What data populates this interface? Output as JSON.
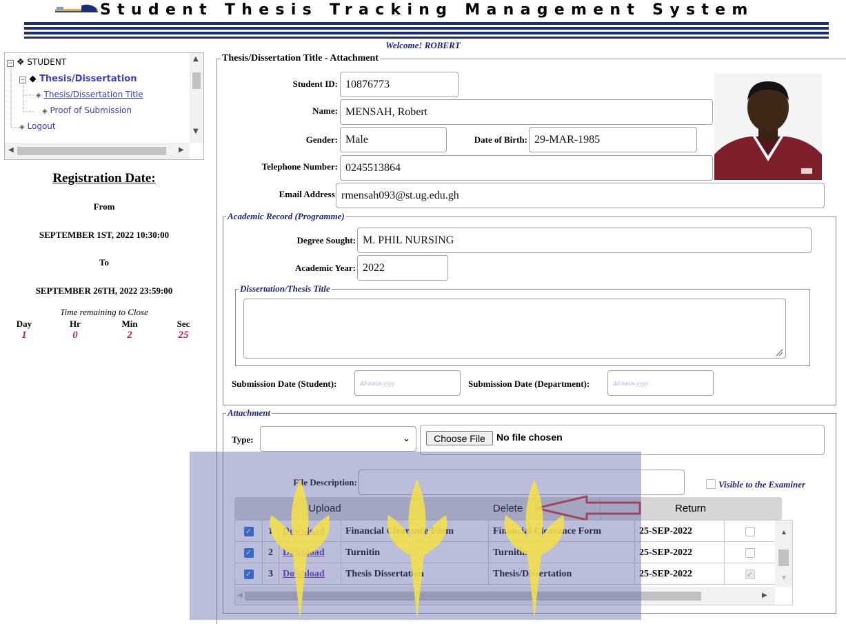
{
  "header": {
    "title": "Student Thesis Tracking Management System",
    "welcome": "Welcome! ROBERT"
  },
  "tree": {
    "root": "STUDENT",
    "section": "Thesis/Dissertation",
    "items": [
      "Thesis/Dissertation Title",
      "Proof of Submission"
    ],
    "logout": "Logout"
  },
  "registration": {
    "heading": "Registration Date:",
    "from_label": "From",
    "from_value": "SEPTEMBER 1ST, 2022 10:30:00",
    "to_label": "To",
    "to_value": "SEPTEMBER 26TH, 2022 23:59:00",
    "timer_label": "Time remaining to Close",
    "timer": [
      {
        "unit": "Day",
        "value": "1"
      },
      {
        "unit": "Hr",
        "value": "0"
      },
      {
        "unit": "Min",
        "value": "2"
      },
      {
        "unit": "Sec",
        "value": "25"
      }
    ]
  },
  "form": {
    "legend": "Thesis/Dissertation Title - Attachment",
    "student_id_label": "Student ID:",
    "student_id": "10876773",
    "name_label": "Name:",
    "name": "MENSAH, Robert",
    "gender_label": "Gender:",
    "gender": "Male",
    "dob_label": "Date of Birth:",
    "dob": "29-MAR-1985",
    "phone_label": "Telephone Number:",
    "phone": "0245513864",
    "email_label": "Email Address:",
    "email": "rmensah093@st.ug.edu.gh"
  },
  "academic": {
    "legend": "Academic Record (Programme)",
    "degree_label": "Degree Sought:",
    "degree": "M. PHIL NURSING",
    "year_label": "Academic Year:",
    "year": "2022",
    "title_legend": "Dissertation/Thesis Title",
    "title_value": "",
    "sub_student_label": "Submission Date (Student):",
    "sub_dept_label": "Submission Date (Department):",
    "date_placeholder": "dd-mmm-yyyy"
  },
  "attachment": {
    "legend": "Attachment",
    "type_label": "Type:",
    "type_value": "",
    "choose_file": "Choose File",
    "no_file": "No file chosen",
    "file_desc_label": "File Description:",
    "visible_label": "Visible to the Examiner",
    "buttons": {
      "upload": "Upload",
      "delete": "Delete",
      "return": "Return"
    },
    "rows": [
      {
        "checked": true,
        "num": "1",
        "link": "Download",
        "desc": "Financial Clearance Form",
        "type": "Financial Clearance Form",
        "date": "25-SEP-2022",
        "visible": false
      },
      {
        "checked": true,
        "num": "2",
        "link": "Download",
        "desc": "Turnitin",
        "type": "Turnitin",
        "date": "25-SEP-2022",
        "visible": false
      },
      {
        "checked": true,
        "num": "3",
        "link": "Download",
        "desc": "Thesis Dissertation",
        "type": "Thesis/Dissertation",
        "date": "25-SEP-2022",
        "visible": true
      }
    ]
  },
  "colors": {
    "header_bar": "#1a2f78",
    "link": "#5b2ea6",
    "timer": "#c2185b",
    "accent_text": "#1a237e",
    "annotation_arrow": "#d32f2f"
  }
}
